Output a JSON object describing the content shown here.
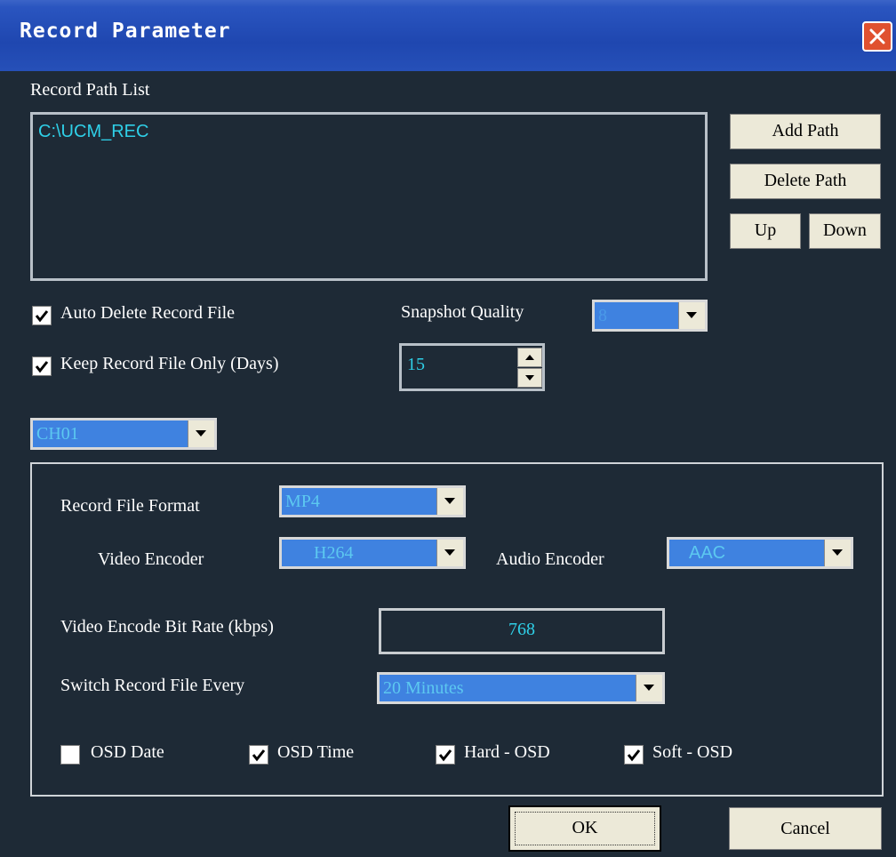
{
  "window": {
    "title": "Record Parameter"
  },
  "path_section": {
    "label": "Record Path List",
    "paths": [
      "C:\\UCM_REC"
    ],
    "add_label": "Add Path",
    "delete_label": "Delete Path",
    "up_label": "Up",
    "down_label": "Down"
  },
  "options": {
    "auto_delete": {
      "label": "Auto Delete Record File",
      "checked": true
    },
    "keep_days": {
      "label": "Keep Record File Only (Days)",
      "checked": true,
      "value": "15"
    },
    "snapshot": {
      "label": "Snapshot Quality",
      "value": "8"
    }
  },
  "channel": {
    "value": "CH01"
  },
  "format_group": {
    "file_format": {
      "label": "Record File Format",
      "value": "MP4"
    },
    "video_encoder": {
      "label": "Video Encoder",
      "value": "H264"
    },
    "audio_encoder": {
      "label": "Audio Encoder",
      "value": "AAC"
    },
    "bitrate": {
      "label": "Video Encode Bit Rate (kbps)",
      "value": "768"
    },
    "switch": {
      "label": "Switch Record File Every",
      "value": "20 Minutes"
    },
    "osd": [
      {
        "label": "OSD Date",
        "checked": false
      },
      {
        "label": "OSD Time",
        "checked": true
      },
      {
        "label": "Hard - OSD",
        "checked": true
      },
      {
        "label": "Soft - OSD",
        "checked": true
      }
    ]
  },
  "footer": {
    "ok_label": "OK",
    "cancel_label": "Cancel"
  },
  "colors": {
    "background": "#1e2a36",
    "titlebar": "#2a55c0",
    "value_text": "#2fd0e8",
    "combo_fill": "#3f82e0"
  }
}
